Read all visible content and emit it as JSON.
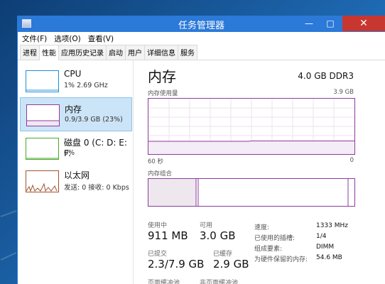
{
  "window": {
    "title": "任务管理器"
  },
  "menu": [
    "文件(F)",
    "选项(O)",
    "查看(V)"
  ],
  "tabs": [
    "进程",
    "性能",
    "应用历史记录",
    "启动",
    "用户",
    "详细信息",
    "服务"
  ],
  "active_tab": "性能",
  "resources": [
    {
      "name": "CPU",
      "sub": "1% 2.69 GHz",
      "color": "#1c8fd6"
    },
    {
      "name": "内存",
      "sub": "0.9/3.9 GB (23%)",
      "color": "#8b3d9d"
    },
    {
      "name": "磁盘 0 (C: D: E: F:",
      "sub": "0%",
      "color": "#4ca82a"
    },
    {
      "name": "以太网",
      "sub": "发送: 0 接收: 0 Kbps",
      "color": "#a0522d"
    }
  ],
  "detail": {
    "title": "内存",
    "spec": "4.0 GB DDR3",
    "usage_label": "内存使用量",
    "max_label": "3.9 GB",
    "time_label": "60 秒",
    "zero_label": "0",
    "composition_label": "内存组合",
    "used_fraction": 0.23
  },
  "stats": {
    "in_use_label": "使用中",
    "in_use": "911 MB",
    "available_label": "可用",
    "available": "3.0 GB",
    "committed_label": "已提交",
    "committed": "2.3/7.9 GB",
    "cached_label": "已缓存",
    "cached": "2.9 GB",
    "paged_pool_label": "页面缓冲池",
    "nonpaged_pool_label": "非页面缓冲池"
  },
  "hw": [
    {
      "label": "速度:",
      "value": "1333 MHz"
    },
    {
      "label": "已使用的插槽:",
      "value": "1/4"
    },
    {
      "label": "组成要素:",
      "value": "DIMM"
    },
    {
      "label": "为硬件保留的内存:",
      "value": "54.6 MB"
    }
  ]
}
